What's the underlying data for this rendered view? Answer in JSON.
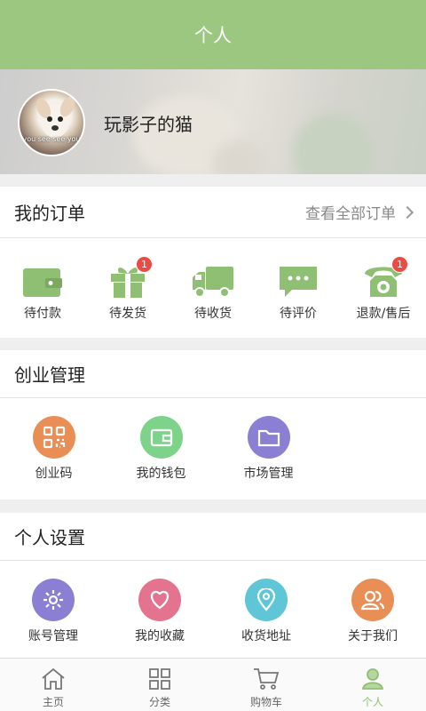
{
  "header": {
    "title": "个人"
  },
  "profile": {
    "username": "玩影子的猫",
    "avatar_caption": "you see see you"
  },
  "orders": {
    "title": "我的订单",
    "view_all": "查看全部订单",
    "items": [
      {
        "label": "待付款",
        "icon": "wallet-icon",
        "badge": ""
      },
      {
        "label": "待发货",
        "icon": "gift-icon",
        "badge": "1"
      },
      {
        "label": "待收货",
        "icon": "truck-icon",
        "badge": ""
      },
      {
        "label": "待评价",
        "icon": "comment-icon",
        "badge": ""
      },
      {
        "label": "退款/售后",
        "icon": "phone-icon",
        "badge": "1"
      }
    ]
  },
  "business": {
    "title": "创业管理",
    "items": [
      {
        "label": "创业码",
        "icon": "qrcode-icon",
        "color": "#e98f56"
      },
      {
        "label": "我的钱包",
        "icon": "wallet-icon",
        "color": "#7ed38a"
      },
      {
        "label": "市场管理",
        "icon": "folder-icon",
        "color": "#8a7fd3"
      }
    ]
  },
  "settings": {
    "title": "个人设置",
    "items": [
      {
        "label": "账号管理",
        "icon": "gear-icon",
        "color": "#8a7fd3"
      },
      {
        "label": "我的收藏",
        "icon": "heart-icon",
        "color": "#e4738f"
      },
      {
        "label": "收货地址",
        "icon": "location-icon",
        "color": "#5ec6d6"
      },
      {
        "label": "关于我们",
        "icon": "users-icon",
        "color": "#e98f56"
      }
    ]
  },
  "tabbar": {
    "items": [
      {
        "label": "主页",
        "icon": "home-icon"
      },
      {
        "label": "分类",
        "icon": "grid-icon"
      },
      {
        "label": "购物车",
        "icon": "cart-icon"
      },
      {
        "label": "个人",
        "icon": "person-icon",
        "active": true
      }
    ]
  },
  "colors": {
    "brand": "#9cc781",
    "order_icon": "#8fbf73",
    "badge": "#ea4b45"
  }
}
